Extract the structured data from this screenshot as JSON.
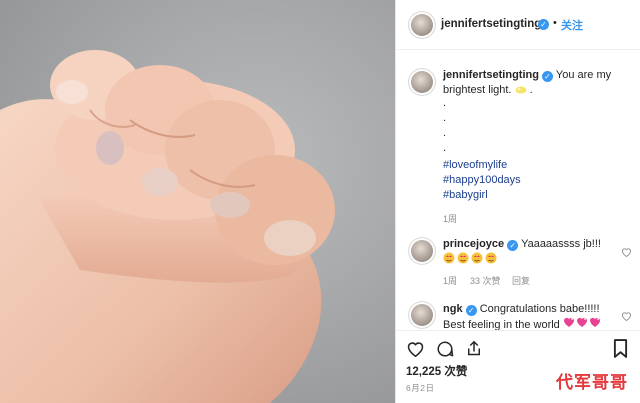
{
  "post": {
    "photo_description_icon": "baby-hand-holding-finger-photo",
    "author": "jennifertsetingting",
    "follow_label": "关注",
    "separator": "•",
    "caption": {
      "username": "jennifertsetingting",
      "text_line1": "You are my",
      "text_line2": "brightest light.",
      "after_emoji": ".",
      "dots": [
        ".",
        ".",
        ".",
        "."
      ],
      "hashtags": [
        "#loveofmylife",
        "#happy100days",
        "#babygirl"
      ],
      "time": "1周"
    },
    "comments": [
      {
        "username": "princejoyce",
        "text": "Yaaaaassss jb!!!",
        "emoji_count": 4,
        "time": "1周",
        "likes": "33 次赞",
        "reply": "回复"
      },
      {
        "username": "ngk",
        "text_line1": "Congratulations babe!!!!!",
        "text_line2": "Best feeling in the world",
        "emoji_count": 3
      }
    ],
    "likes_count": "12,225 次赞",
    "date": "6月2日"
  },
  "watermark": "代军哥哥",
  "colors": {
    "link_blue": "#3897f0",
    "hashtag_blue": "#1b3f8f",
    "meta_gray": "#8e8e8e",
    "watermark_red": "#e4393c"
  }
}
